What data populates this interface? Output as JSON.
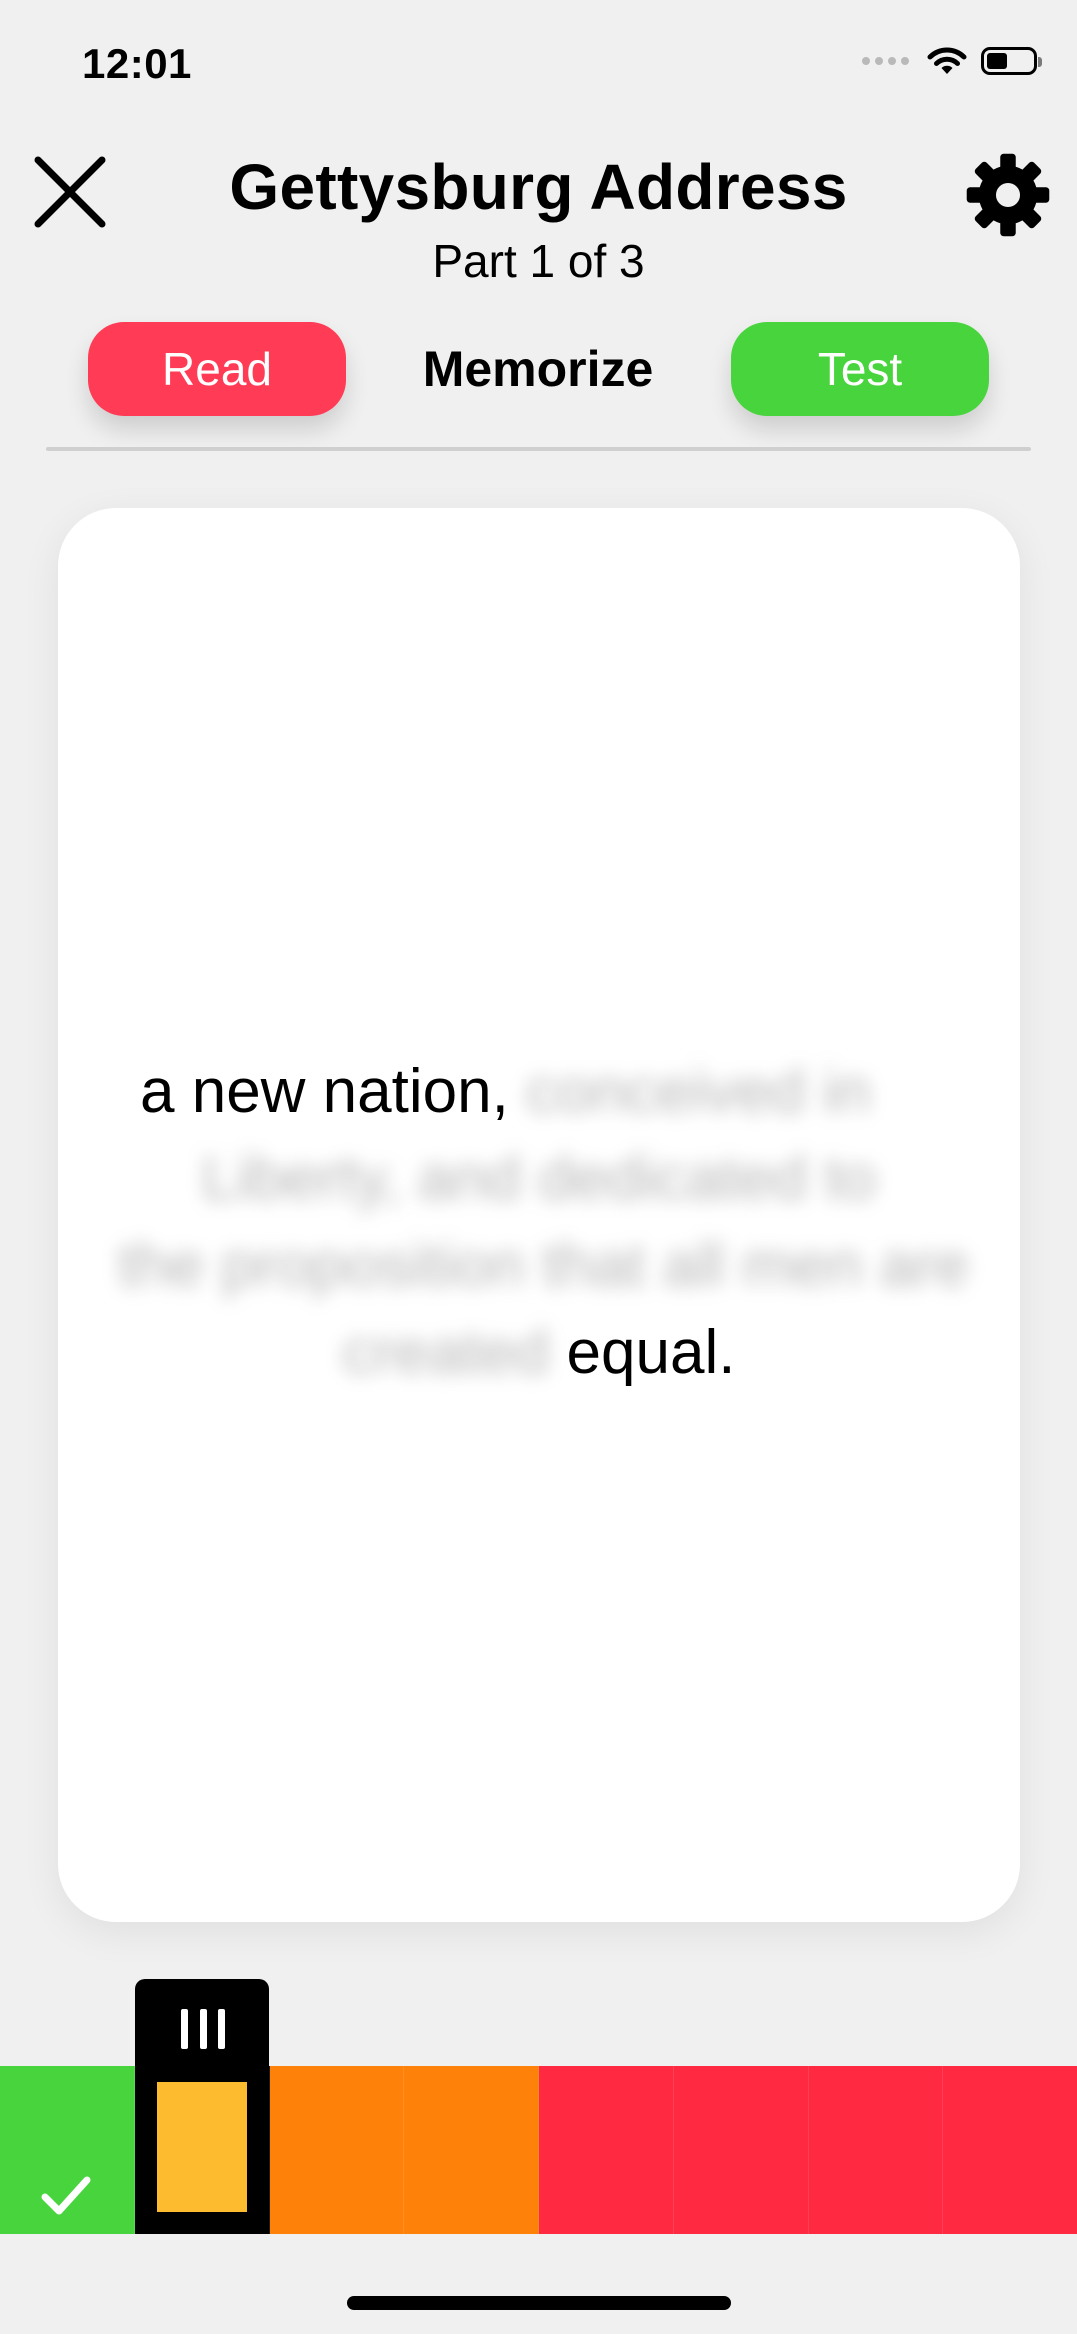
{
  "status_bar": {
    "time": "12:01",
    "icons": [
      "cellular-signal-icon",
      "wifi-icon",
      "battery-icon"
    ]
  },
  "header": {
    "title": "Gettysburg Address",
    "subtitle": "Part 1 of 3",
    "close_icon": "close-x-icon",
    "settings_icon": "gear-icon"
  },
  "modes": {
    "read_label": "Read",
    "memorize_label": "Memorize",
    "test_label": "Test",
    "active": "Memorize"
  },
  "card": {
    "visible_start": "a new nation,",
    "hidden_line_1": "conceived in",
    "hidden_line_2": "Liberty, and dedicated to",
    "hidden_line_3": "the proposition that all men are",
    "hidden_line_4": "created",
    "visible_end": "equal."
  },
  "progress": {
    "segments": [
      {
        "status": "done",
        "color": "#47d43c"
      },
      {
        "status": "current",
        "color": "#fdbb30"
      },
      {
        "status": "medium",
        "color": "#fe8209"
      },
      {
        "status": "medium",
        "color": "#fe8209"
      },
      {
        "status": "low",
        "color": "#ff2a42"
      },
      {
        "status": "low",
        "color": "#ff2a42"
      },
      {
        "status": "low",
        "color": "#ff2a42"
      },
      {
        "status": "low",
        "color": "#ff2a42"
      }
    ],
    "current_index": 1,
    "done_icon": "check-icon",
    "handle_icon": "grip-lines-icon"
  },
  "colors": {
    "read": "#ff3b55",
    "test": "#47d43c",
    "background": "#f0f0f0"
  }
}
